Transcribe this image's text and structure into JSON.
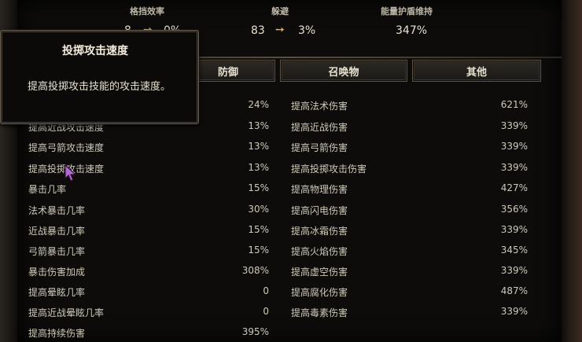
{
  "top_stats": [
    {
      "label": "格挡效率",
      "value": "8",
      "arrow_value": "0%"
    },
    {
      "label": "躲避",
      "value": "83",
      "arrow_value": "3%"
    },
    {
      "label": "能量护盾维持",
      "value": "347%"
    }
  ],
  "tabs": [
    "防御",
    "召唤物",
    "其他"
  ],
  "tooltip": {
    "title": "投掷攻击速度",
    "body": "提高投掷攻击技能的攻击速度。"
  },
  "left_rows": [
    {
      "label": "",
      "value": "24%"
    },
    {
      "label": "提高近战攻击速度",
      "value": "13%"
    },
    {
      "label": "提高弓箭攻击速度",
      "value": "13%"
    },
    {
      "label": "提高投掷攻击速度",
      "value": "13%"
    },
    {
      "label": "暴击几率",
      "value": "15%"
    },
    {
      "label": "法术暴击几率",
      "value": "30%"
    },
    {
      "label": "近战暴击几率",
      "value": "15%"
    },
    {
      "label": "弓箭暴击几率",
      "value": "15%"
    },
    {
      "label": "暴击伤害加成",
      "value": "308%"
    },
    {
      "label": "提高晕眩几率",
      "value": "0"
    },
    {
      "label": "提高近战晕眩几率",
      "value": "0"
    },
    {
      "label": "提高持续伤害",
      "value": "395%"
    }
  ],
  "right_rows": [
    {
      "label": "提高法术伤害",
      "value": "621%"
    },
    {
      "label": "提高近战伤害",
      "value": "339%"
    },
    {
      "label": "提高弓箭伤害",
      "value": "339%"
    },
    {
      "label": "提高投掷攻击伤害",
      "value": "339%"
    },
    {
      "label": "提高物理伤害",
      "value": "427%"
    },
    {
      "label": "提高闪电伤害",
      "value": "356%"
    },
    {
      "label": "提高冰霜伤害",
      "value": "339%"
    },
    {
      "label": "提高火焰伤害",
      "value": "345%"
    },
    {
      "label": "提高虚空伤害",
      "value": "339%"
    },
    {
      "label": "提高腐化伤害",
      "value": "487%"
    },
    {
      "label": "提高毒素伤害",
      "value": "339%"
    }
  ],
  "colors": {
    "arrow": "#e6b84a",
    "text": "#cfc9b9",
    "border": "#5e554a"
  }
}
